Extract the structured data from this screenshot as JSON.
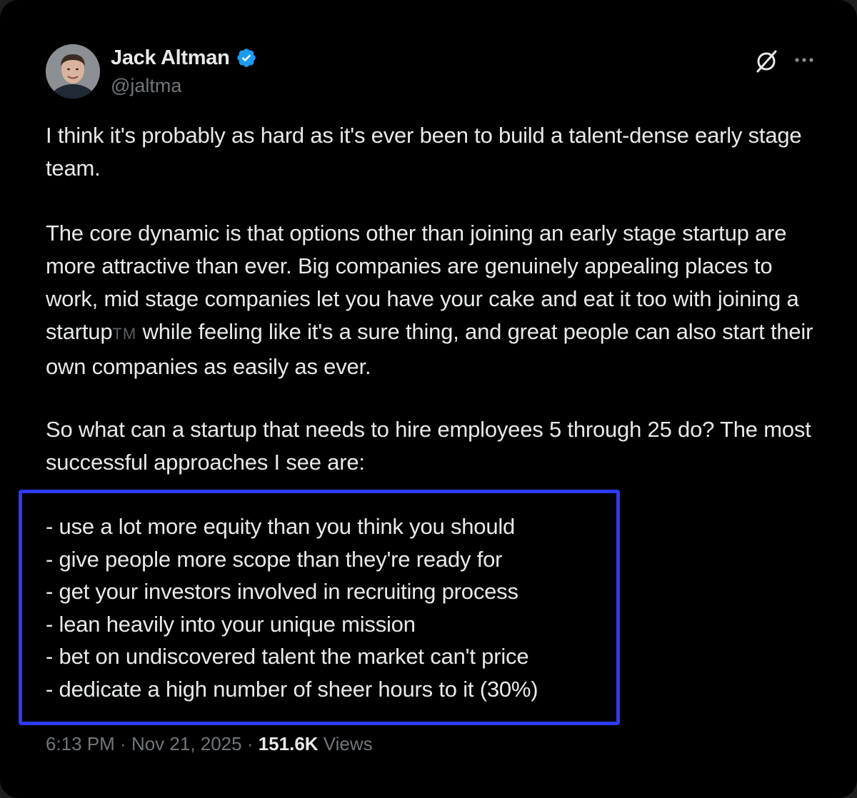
{
  "author": {
    "name": "Jack Altman",
    "handle": "@jaltma",
    "verified_color": "#1d9bf0"
  },
  "icons": {
    "grok": "grok-slash-circle-icon",
    "more": "more-horizontal-icon",
    "verified": "verified-badge-icon"
  },
  "tweet": {
    "paragraph1": "I think it's probably as hard as it's ever been to build a talent-dense early stage team.",
    "paragraph2_part1": "The core dynamic is that options other than joining an early stage startup are more attractive than ever. Big companies are genuinely appealing places to work, mid stage companies let you have your cake and eat it too with joining a startup",
    "paragraph2_tm": "TM",
    "paragraph2_part2": " while feeling like it's a sure thing, and great people can also start their own companies as easily as ever.",
    "paragraph3": "So what can a startup that needs to hire employees 5 through 25 do? The most successful approaches I see are:",
    "list_items": [
      "- use a lot more equity than you think you should",
      "- give people more scope than they're ready for",
      "- get your investors involved in recruiting process",
      "- lean heavily into your unique mission",
      "- bet on undiscovered talent the market can't price",
      "- dedicate a high number of sheer hours to it (30%)"
    ]
  },
  "highlight_color": "#2f3bf0",
  "meta": {
    "time": "6:13 PM",
    "separator": " · ",
    "date": "Nov 21, 2025",
    "views_count": "151.6K",
    "views_label": " Views"
  }
}
